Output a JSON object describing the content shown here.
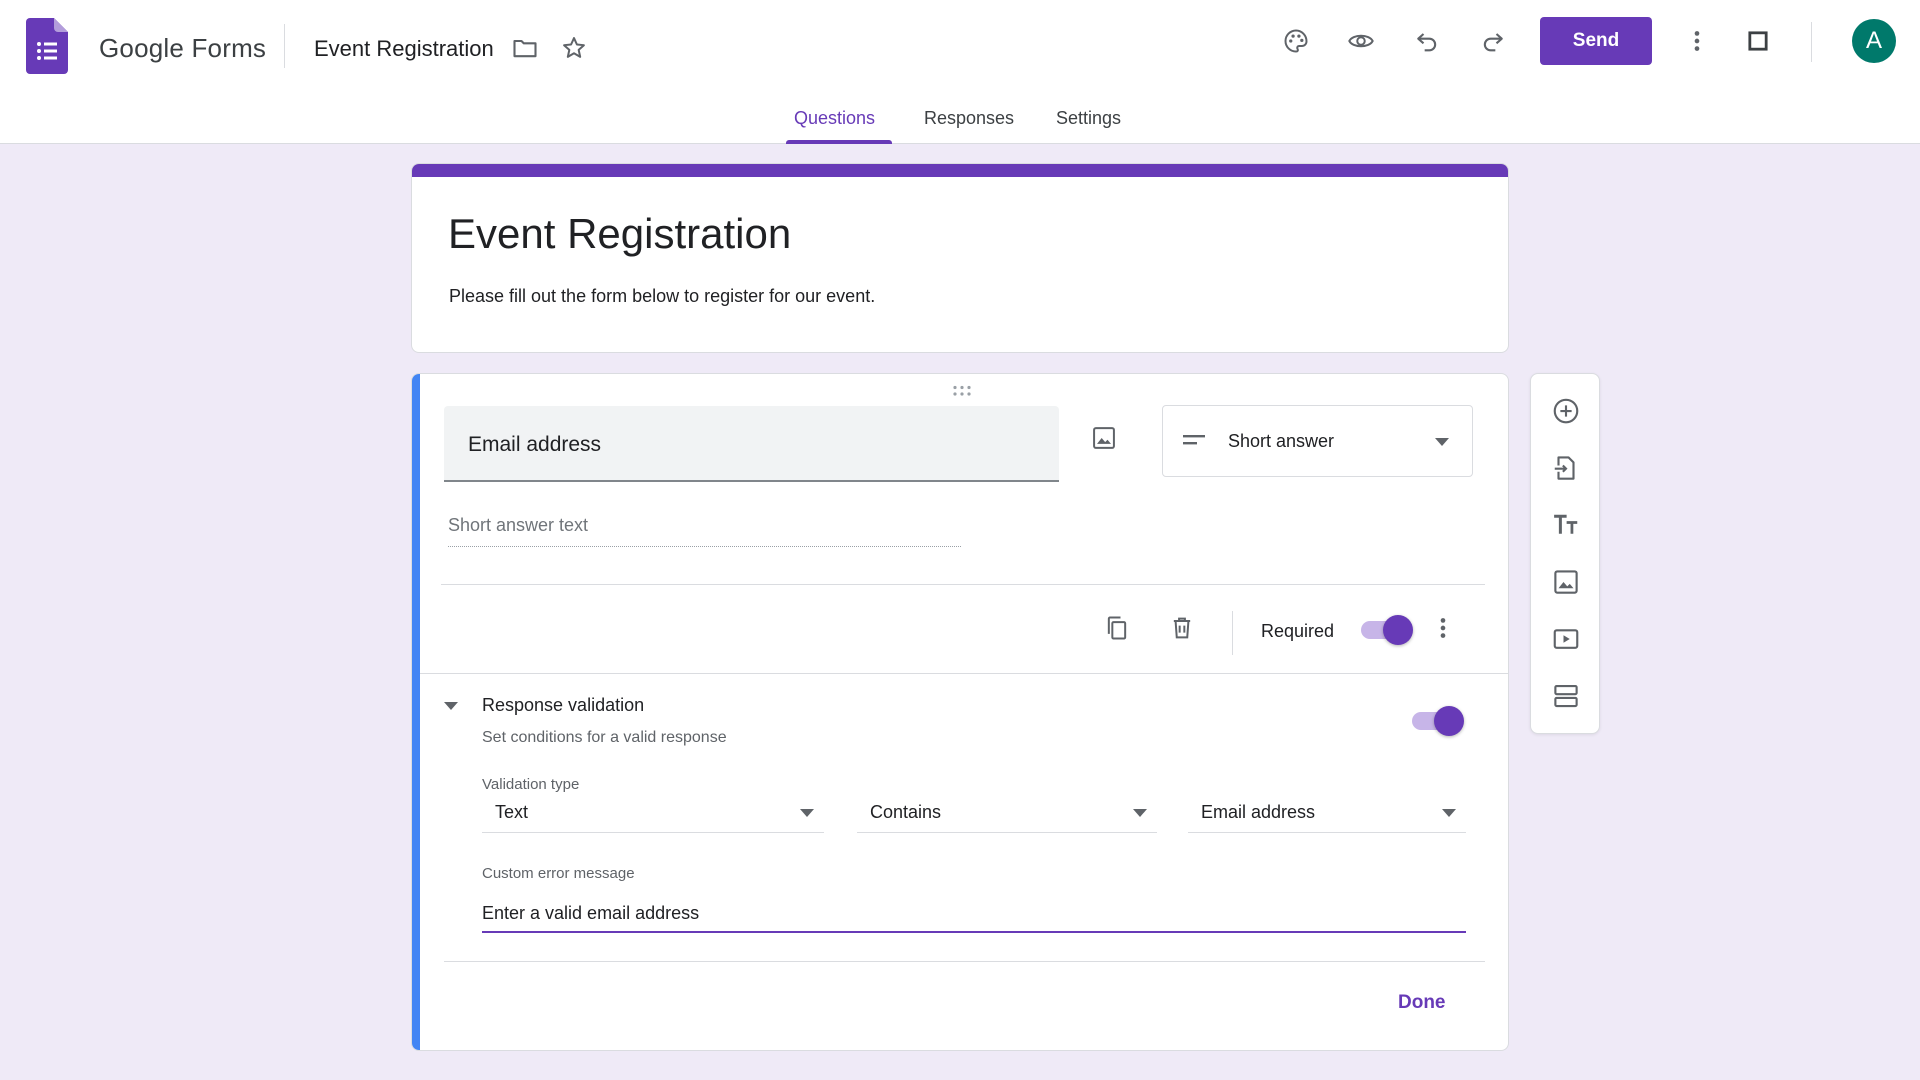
{
  "header": {
    "app_name": "Google Forms",
    "doc_title": "Event Registration",
    "send_label": "Send",
    "avatar_initial": "A",
    "accent_color": "#673ab7"
  },
  "tabs": [
    {
      "label": "Questions",
      "active": true
    },
    {
      "label": "Responses",
      "active": false
    },
    {
      "label": "Settings",
      "active": false
    }
  ],
  "form": {
    "title": "Event Registration",
    "description": "Please fill out the form below to register for our event."
  },
  "question": {
    "title": "Email address",
    "type": "Short answer",
    "answer_placeholder": "Short answer text",
    "required_label": "Required",
    "required": true,
    "validation": {
      "title": "Response validation",
      "subtitle": "Set conditions for a valid response",
      "enabled": true,
      "type_label": "Validation type",
      "type": "Text",
      "condition": "Contains",
      "pattern": "Email address",
      "error_label": "Custom error message",
      "error_message": "Enter a valid email address"
    },
    "done_label": "Done"
  },
  "side_toolbar": [
    "add-question-icon",
    "import-questions-icon",
    "add-title-icon",
    "add-image-icon",
    "add-video-icon",
    "add-section-icon"
  ],
  "header_icons": [
    "palette-icon",
    "preview-eye-icon",
    "undo-icon",
    "redo-icon",
    "more-vert-icon",
    "square-icon"
  ]
}
